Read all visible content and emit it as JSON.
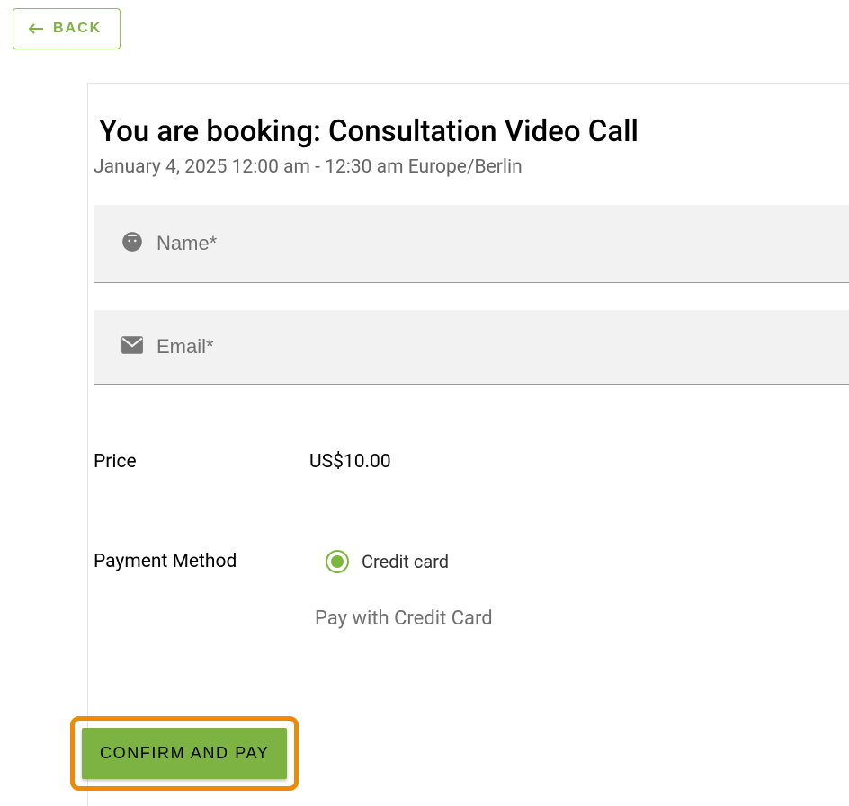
{
  "back": {
    "label": "BACK"
  },
  "title_prefix": "You are booking: ",
  "service_name": "Consultation Video Call",
  "datetime_range": "January 4, 2025 12:00 am - 12:30 am Europe/Berlin",
  "fields": {
    "name_placeholder": "Name*",
    "email_placeholder": "Email*"
  },
  "price": {
    "label": "Price",
    "value": "US$10.00"
  },
  "payment_method": {
    "label": "Payment Method",
    "option_credit_card": "Credit card",
    "pay_with_label": "Pay with Credit Card"
  },
  "confirm_label": "CONFIRM AND PAY"
}
